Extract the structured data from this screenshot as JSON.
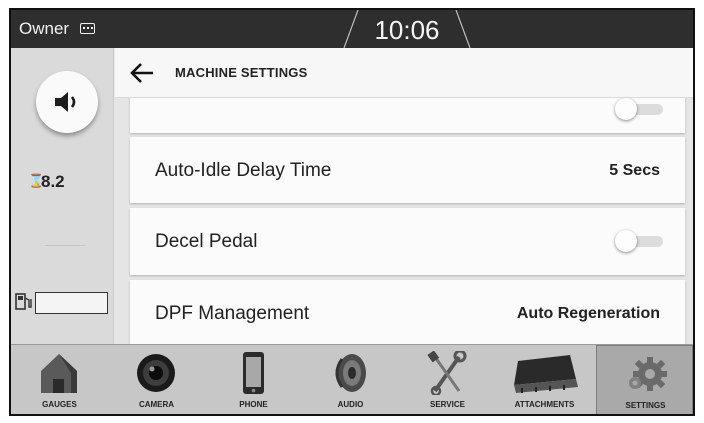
{
  "status_bar": {
    "user": "Owner",
    "user_icon": "keyboard-icon",
    "time": "10:06"
  },
  "left_rail": {
    "volume_icon": "speaker-icon",
    "hour_icon": "hourglass-icon",
    "hour_glyph": "⌛",
    "engine_hours": "8.2",
    "fuel_icon": "fuel-pump-icon",
    "fuel_level": 0
  },
  "header": {
    "back_icon": "arrow-left-icon",
    "title": "MACHINE SETTINGS"
  },
  "settings": {
    "auto_idle": {
      "label": "Auto-Idle Delay Time",
      "value": "5 Secs"
    },
    "decel_pedal": {
      "label": "Decel Pedal",
      "toggle_on": false
    },
    "dpf": {
      "label": "DPF Management",
      "value": "Auto Regeneration"
    }
  },
  "nav": {
    "items": [
      {
        "label": "GAUGES",
        "icon": "house-icon"
      },
      {
        "label": "CAMERA",
        "icon": "camera-lens-icon"
      },
      {
        "label": "PHONE",
        "icon": "phone-icon"
      },
      {
        "label": "AUDIO",
        "icon": "speaker-icon"
      },
      {
        "label": "SERVICE",
        "icon": "wrench-screwdriver-icon"
      },
      {
        "label": "ATTACHMENTS",
        "icon": "bucket-icon"
      },
      {
        "label": "SETTINGS",
        "icon": "gear-icon"
      }
    ],
    "active_index": 6
  },
  "colors": {
    "topbar": "#2e2e2e",
    "panel": "#fbfbfb",
    "nav_bg": "#c7c7c7",
    "nav_active": "#a9a9a9"
  }
}
